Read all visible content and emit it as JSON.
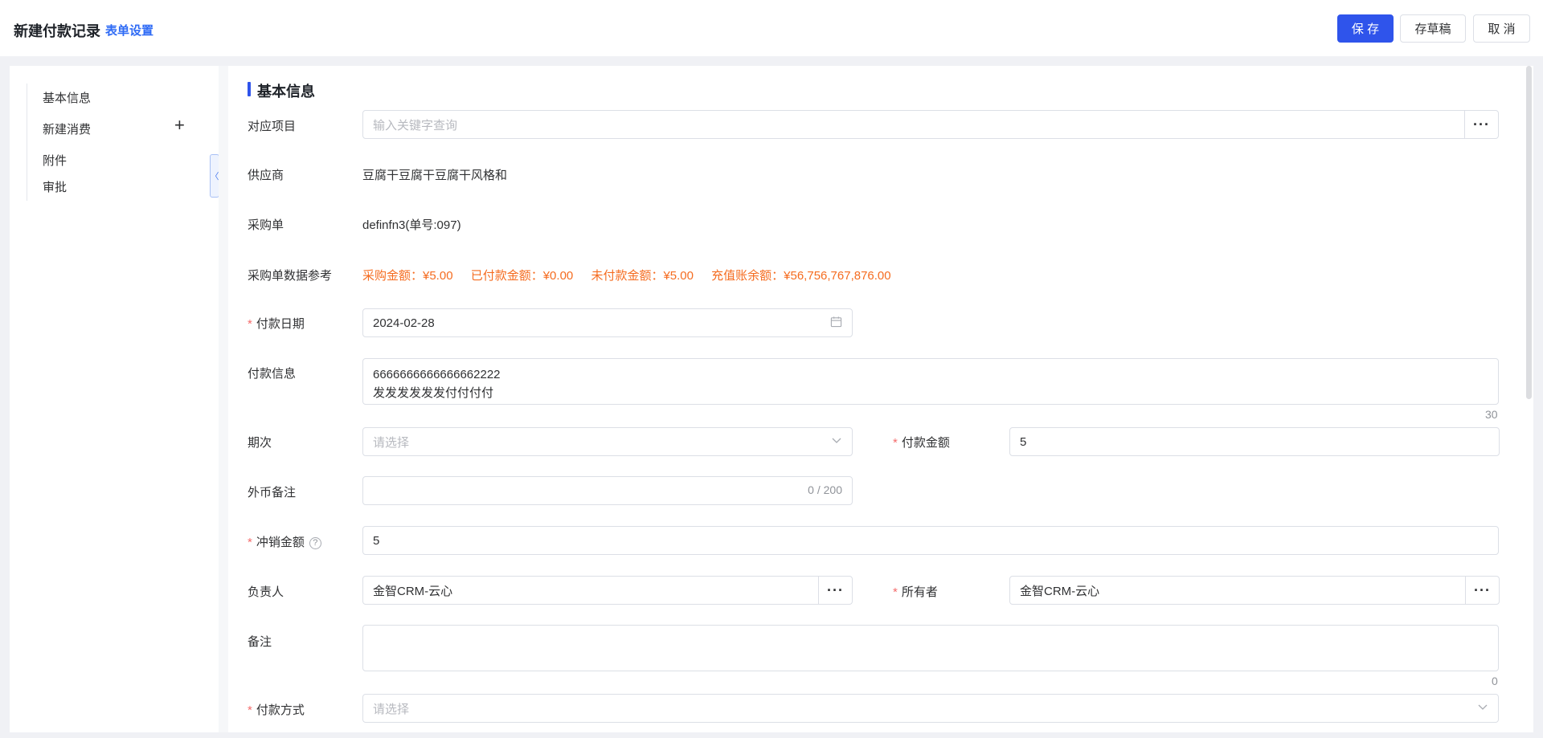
{
  "header": {
    "title": "新建付款记录",
    "form_settings": "表单设置",
    "save": "保 存",
    "draft": "存草稿",
    "cancel": "取 消"
  },
  "sidebar": {
    "items": [
      "基本信息",
      "新建消费",
      "附件",
      "审批"
    ],
    "add_icon": "plus-icon",
    "collapse_icon": "chevron-left-icon"
  },
  "section": {
    "title": "基本信息"
  },
  "fields": {
    "project": {
      "label": "对应项目",
      "placeholder": "输入关键字查询",
      "button": "···"
    },
    "supplier": {
      "label": "供应商",
      "value": "豆腐干豆腐干豆腐干风格和"
    },
    "purchase_order": {
      "label": "采购单",
      "value": "definfn3(单号:097)"
    },
    "po_reference": {
      "label": "采购单数据参考",
      "items": [
        "采购金额：¥5.00",
        "已付款金额：¥0.00",
        "未付款金额：¥5.00",
        "充值账余额：¥56,756,767,876.00"
      ]
    },
    "payment_date": {
      "label": "付款日期",
      "value": "2024-02-28",
      "icon": "calendar-icon"
    },
    "payment_info": {
      "label": "付款信息",
      "line1": "6666666666666662222",
      "line2": "发发发发发发付付付付",
      "count": "30"
    },
    "period": {
      "label": "期次",
      "placeholder": "请选择",
      "icon": "chevron-down-icon"
    },
    "payment_amount": {
      "label": "付款金额",
      "value": "5"
    },
    "fx_note": {
      "label": "外币备注",
      "counter": "0 / 200"
    },
    "offset_amount": {
      "label": "冲销金额",
      "value": "5",
      "help": "?"
    },
    "responsible": {
      "label": "负责人",
      "value": "金智CRM-云心",
      "button": "···"
    },
    "owner": {
      "label": "所有者",
      "value": "金智CRM-云心",
      "button": "···"
    },
    "remark": {
      "label": "备注",
      "count": "0"
    },
    "payment_method": {
      "label": "付款方式",
      "placeholder": "请选择",
      "icon": "chevron-down-icon"
    }
  },
  "required_mark": "*",
  "colors": {
    "primary": "#2f54eb",
    "warning_text": "#f56c20",
    "required": "#f56c6c",
    "link": "#2f6bf5"
  }
}
